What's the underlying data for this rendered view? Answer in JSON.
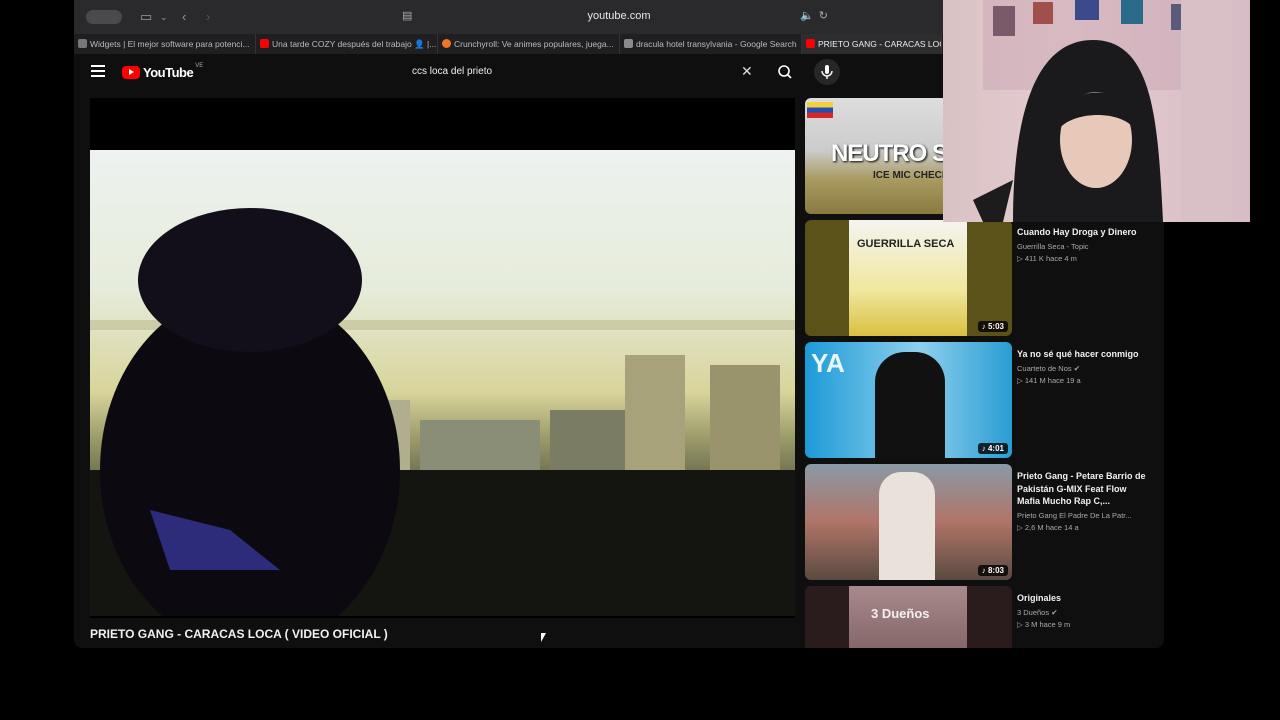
{
  "browser": {
    "url": "youtube.com",
    "tabs": [
      {
        "label": "Widgets | El mejor software para potenci...",
        "color": "#666666"
      },
      {
        "label": "Una tarde COZY después del trabajo 👤 |...",
        "color": "#ff0000"
      },
      {
        "label": "Crunchyroll: Ve animes populares, juega...",
        "color": "#f47521"
      },
      {
        "label": "dracula hotel transylvania - Google Search",
        "color": "#8a8a8a"
      },
      {
        "label": "PRIETO GANG - CARACAS LOCA",
        "color": "#ff0000"
      }
    ]
  },
  "youtube": {
    "logo_text": "YouTube",
    "country_code": "VE",
    "search_query": "ccs loca del prieto"
  },
  "video": {
    "title": "PRIETO GANG - CARACAS LOCA ( VIDEO OFICIAL )"
  },
  "recommendations": [
    {
      "thumb_text": "NEUTRO SHO",
      "thumb_subtext": "ICE MIC CHECK",
      "title": "",
      "channel": "",
      "stats": "",
      "duration": ""
    },
    {
      "thumb_text": "GUERRILLA SECA",
      "title": "Cuando Hay Droga y Dinero",
      "channel": "Guerrilla Seca - Topic",
      "stats": "411 K  hace 4 m",
      "duration": "5:03"
    },
    {
      "thumb_text": "YA",
      "title": "Ya no sé qué hacer conmigo",
      "channel": "Cuarteto de Nos",
      "stats": "141 M  hace 19 a",
      "duration": "4:01"
    },
    {
      "thumb_text": "",
      "title": "Prieto Gang - Petare Barrio de Pakistán G-MIX Feat Flow Mafia  Mucho Rap C,...",
      "channel": "Prieto Gang El Padre De La Patr...",
      "stats": "2,6 M  hace 14 a",
      "duration": "8:03"
    },
    {
      "thumb_text": "3 Dueños",
      "title": "Originales",
      "channel": "3 Dueños",
      "stats": "3 M  hace 9 m",
      "duration": ""
    }
  ]
}
